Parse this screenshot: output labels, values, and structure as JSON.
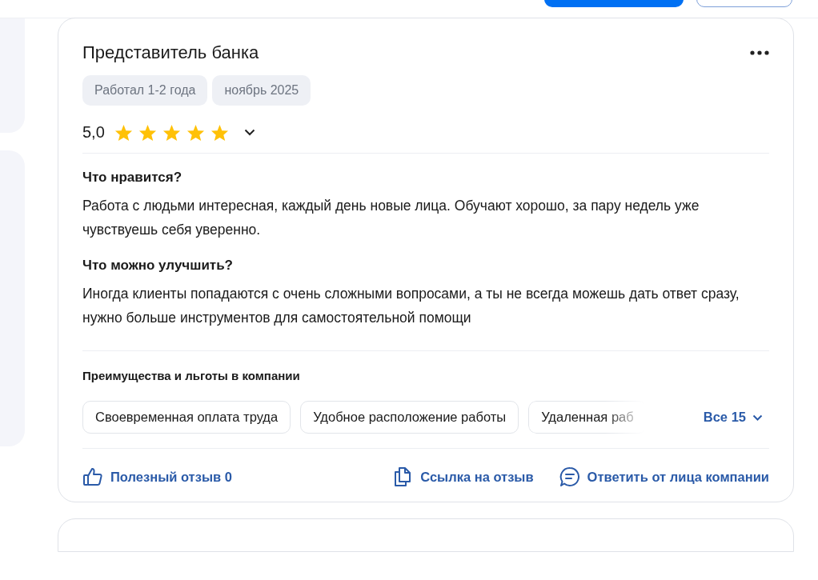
{
  "review": {
    "title": "Представитель банка",
    "tags": [
      "Работал 1-2 года",
      "ноябрь 2025"
    ],
    "rating": "5,0",
    "stars": 5,
    "sections": [
      {
        "heading": "Что нравится?",
        "text": "Работа с людьми интересная, каждый день новые лица. Обучают хорошо, за пару недель уже чувствуешь себя уверенно."
      },
      {
        "heading": "Что можно улучшить?",
        "text": "Иногда клиенты попадаются с очень сложными вопросами, а ты не всегда можешь дать ответ сразу, нужно больше инструментов для самостоятельной помощи"
      }
    ],
    "benefits_heading": "Преимущества и льготы в компании",
    "benefits": [
      "Своевременная оплата труда",
      "Удобное расположение работы",
      "Удаленная раб"
    ],
    "benefits_more": "Все 15",
    "actions": [
      {
        "kind": "like",
        "label": "Полезный отзыв 0"
      },
      {
        "kind": "copy",
        "label": "Ссылка на отзыв"
      },
      {
        "kind": "reply",
        "label": "Ответить от лица компании"
      }
    ]
  }
}
